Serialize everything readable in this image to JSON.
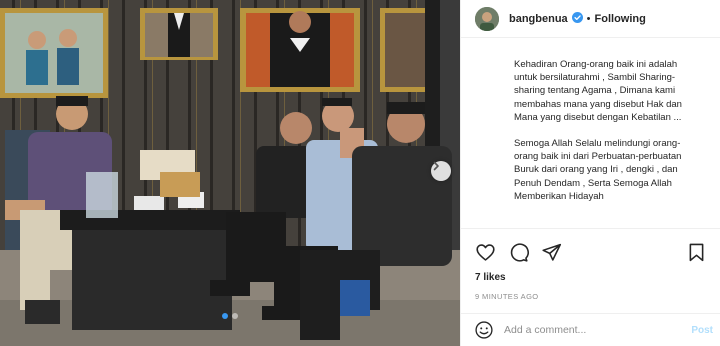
{
  "header": {
    "username": "bangbenua",
    "separator": "•",
    "follow_label": "Following",
    "verified_icon": "verified-badge-icon"
  },
  "caption": {
    "paragraph_1": "Kehadiran Orang-orang baik ini adalah untuk bersilaturahmi , Sambil Sharing-sharing tentang Agama , Dimana kami membahas mana yang disebut Hak dan Mana yang disebut dengan Kebatilan ...",
    "paragraph_2": "Semoga Allah Selalu melindungi orang-orang baik ini dari Perbuatan-perbuatan Buruk dari orang yang Iri , dengki , dan Penuh Dendam , Serta Semoga Allah Memberikan Hidayah"
  },
  "actions": {
    "icons": [
      "heart-icon",
      "comment-icon",
      "share-icon",
      "bookmark-icon"
    ],
    "likes": "7 likes",
    "time_ago": "9 MINUTES AGO"
  },
  "comment": {
    "placeholder": "Add a comment...",
    "post_label": "Post"
  },
  "carousel": {
    "total_slides": 2,
    "active_slide": 1
  },
  "colors": {
    "verified_blue": "#3897f0",
    "post_disabled": "#b2dffc",
    "muted_text": "#8e8e8e",
    "border": "#efefef"
  }
}
